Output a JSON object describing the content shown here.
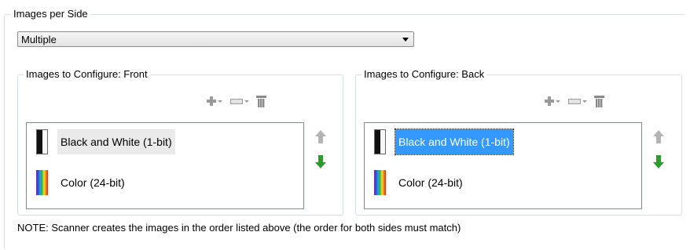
{
  "images_per_side": {
    "legend": "Images per Side",
    "selected": "Multiple"
  },
  "front": {
    "legend": "Images to Configure: Front",
    "items": [
      {
        "label": "Black and White (1-bit)",
        "icon": "bw-page-icon"
      },
      {
        "label": "Color (24-bit)",
        "icon": "color-spectrum-icon"
      }
    ]
  },
  "back": {
    "legend": "Images to Configure: Back",
    "items": [
      {
        "label": "Black and White (1-bit)",
        "icon": "bw-page-icon",
        "selected": true
      },
      {
        "label": "Color (24-bit)",
        "icon": "color-spectrum-icon"
      }
    ]
  },
  "toolbar": {
    "icons": [
      "add-icon",
      "remove-icon",
      "delete-icon"
    ]
  },
  "note": "NOTE: Scanner creates the images in the order listed above (the order for both sides must match)",
  "colors": {
    "selection": "#3399ff",
    "border": "#d5dfe5",
    "move_down": "#2e9b2e",
    "disabled": "#b4b4b4"
  }
}
